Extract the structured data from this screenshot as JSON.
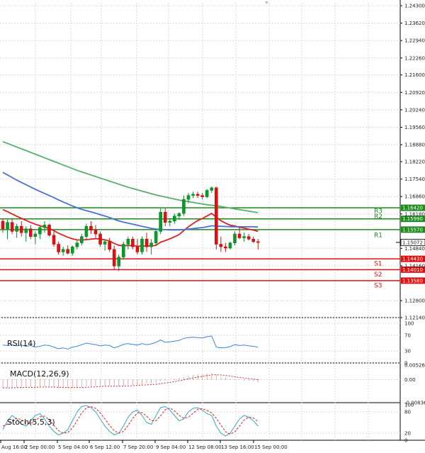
{
  "chart_data": {
    "type": "candlestick",
    "price_axis": {
      "ticks": [
        "1.24300",
        "1.23620",
        "1.22940",
        "1.22260",
        "1.21600",
        "1.20920",
        "1.20240",
        "1.19560",
        "1.18880",
        "1.18220",
        "1.17540",
        "1.16860",
        "1.16180",
        "1.14840",
        "1.14160",
        "1.12800",
        "1.12140"
      ],
      "ylim": [
        1.1214,
        1.243
      ]
    },
    "time_axis": {
      "labels": [
        "Aug 16:00",
        "2 Sep 00:00",
        "5 Sep 04:00",
        "6 Sep 12:00",
        "7 Sep 20:00",
        "9 Sep 04:00",
        "12 Sep 08:00",
        "13 Sep 16:00",
        "15 Sep 00:00"
      ]
    },
    "current_price": "1.15072",
    "levels": [
      {
        "name": "R3",
        "value": "1.16420",
        "color": "#1e8a1e"
      },
      {
        "name": "R2",
        "value": "1.15990",
        "color": "#1e8a1e"
      },
      {
        "name": "R1",
        "value": "1.15570",
        "color": "#1e8a1e"
      },
      {
        "name": "S1",
        "value": "1.14430",
        "color": "#e01010"
      },
      {
        "name": "S2",
        "value": "1.14010",
        "color": "#e01010"
      },
      {
        "name": "S3",
        "value": "1.13580",
        "color": "#e01010"
      }
    ],
    "candles": [
      [
        1.159,
        1.16,
        1.1545,
        1.156
      ],
      [
        1.156,
        1.1595,
        1.152,
        1.1585
      ],
      [
        1.1585,
        1.16,
        1.154,
        1.155
      ],
      [
        1.155,
        1.158,
        1.1525,
        1.157
      ],
      [
        1.157,
        1.159,
        1.153,
        1.1545
      ],
      [
        1.1545,
        1.157,
        1.151,
        1.156
      ],
      [
        1.156,
        1.1575,
        1.152,
        1.153
      ],
      [
        1.153,
        1.155,
        1.15,
        1.154
      ],
      [
        1.154,
        1.157,
        1.152,
        1.1565
      ],
      [
        1.1565,
        1.159,
        1.1545,
        1.1575
      ],
      [
        1.1575,
        1.158,
        1.153,
        1.1535
      ],
      [
        1.1535,
        1.155,
        1.149,
        1.15
      ],
      [
        1.15,
        1.151,
        1.146,
        1.147
      ],
      [
        1.147,
        1.149,
        1.1455,
        1.148
      ],
      [
        1.148,
        1.1495,
        1.146,
        1.1465
      ],
      [
        1.1465,
        1.1495,
        1.1455,
        1.149
      ],
      [
        1.149,
        1.1515,
        1.148,
        1.1505
      ],
      [
        1.1505,
        1.154,
        1.1495,
        1.153
      ],
      [
        1.153,
        1.158,
        1.152,
        1.157
      ],
      [
        1.157,
        1.159,
        1.154,
        1.1555
      ],
      [
        1.1555,
        1.1575,
        1.1525,
        1.154
      ],
      [
        1.154,
        1.155,
        1.149,
        1.15
      ],
      [
        1.15,
        1.152,
        1.1475,
        1.151
      ],
      [
        1.151,
        1.1525,
        1.147,
        1.148
      ],
      [
        1.148,
        1.1495,
        1.14,
        1.1415
      ],
      [
        1.1415,
        1.146,
        1.1395,
        1.145
      ],
      [
        1.145,
        1.151,
        1.144,
        1.15
      ],
      [
        1.15,
        1.153,
        1.148,
        1.152
      ],
      [
        1.152,
        1.153,
        1.148,
        1.149
      ],
      [
        1.149,
        1.152,
        1.146,
        1.147
      ],
      [
        1.147,
        1.153,
        1.146,
        1.152
      ],
      [
        1.152,
        1.1545,
        1.147,
        1.149
      ],
      [
        1.149,
        1.152,
        1.146,
        1.1505
      ],
      [
        1.1505,
        1.156,
        1.1495,
        1.155
      ],
      [
        1.155,
        1.164,
        1.154,
        1.1625
      ],
      [
        1.1625,
        1.164,
        1.157,
        1.1585
      ],
      [
        1.1585,
        1.16,
        1.157,
        1.159
      ],
      [
        1.159,
        1.162,
        1.158,
        1.161
      ],
      [
        1.161,
        1.1625,
        1.1595,
        1.162
      ],
      [
        1.162,
        1.169,
        1.161,
        1.1675
      ],
      [
        1.1675,
        1.17,
        1.166,
        1.169
      ],
      [
        1.169,
        1.1705,
        1.168,
        1.1695
      ],
      [
        1.1695,
        1.1705,
        1.168,
        1.169
      ],
      [
        1.169,
        1.17,
        1.1675,
        1.1685
      ],
      [
        1.1685,
        1.1715,
        1.168,
        1.171
      ],
      [
        1.171,
        1.1725,
        1.17,
        1.172
      ],
      [
        1.172,
        1.1725,
        1.148,
        1.15
      ],
      [
        1.15,
        1.153,
        1.147,
        1.149
      ],
      [
        1.149,
        1.1505,
        1.147,
        1.1485
      ],
      [
        1.1485,
        1.151,
        1.148,
        1.1505
      ],
      [
        1.1505,
        1.155,
        1.1495,
        1.154
      ],
      [
        1.154,
        1.157,
        1.152,
        1.1525
      ],
      [
        1.1525,
        1.1545,
        1.151,
        1.153
      ],
      [
        1.153,
        1.154,
        1.1515,
        1.152
      ],
      [
        1.152,
        1.153,
        1.1505,
        1.151
      ],
      [
        1.151,
        1.152,
        1.148,
        1.1507
      ]
    ],
    "moving_averages": [
      {
        "color": "#e02020",
        "values": [
          1.1635,
          1.1627,
          1.1618,
          1.1609,
          1.1601,
          1.1593,
          1.1585,
          1.1578,
          1.1572,
          1.1567,
          1.1561,
          1.1553,
          1.1543,
          1.1535,
          1.1527,
          1.1521,
          1.1517,
          1.1516,
          1.1518,
          1.152,
          1.1522,
          1.152,
          1.1517,
          1.1513,
          1.1503,
          1.1496,
          1.1494,
          1.1495,
          1.1495,
          1.1492,
          1.1493,
          1.1493,
          1.1493,
          1.1496,
          1.1508,
          1.1514,
          1.1521,
          1.1529,
          1.1538,
          1.1553,
          1.1568,
          1.1581,
          1.1592,
          1.16,
          1.161,
          1.162,
          1.1605,
          1.1592,
          1.1582,
          1.1574,
          1.1571,
          1.1566,
          1.1563,
          1.1559,
          1.1555,
          1.155
        ]
      },
      {
        "color": "#4a6fd8",
        "values": [
          1.178,
          1.177,
          1.176,
          1.175,
          1.1741,
          1.1732,
          1.1723,
          1.1714,
          1.1706,
          1.1698,
          1.169,
          1.1682,
          1.1673,
          1.1665,
          1.1657,
          1.1649,
          1.1642,
          1.1636,
          1.1631,
          1.1626,
          1.1621,
          1.1615,
          1.161,
          1.1604,
          1.1597,
          1.1591,
          1.1586,
          1.1582,
          1.1578,
          1.1574,
          1.157,
          1.1566,
          1.1562,
          1.1559,
          1.1558,
          1.1557,
          1.1556,
          1.1556,
          1.1556,
          1.1557,
          1.1559,
          1.1561,
          1.1563,
          1.1565,
          1.1568,
          1.1572,
          1.1571,
          1.157,
          1.1569,
          1.1568,
          1.1568,
          1.1568,
          1.1568,
          1.1568,
          1.1568,
          1.1567
        ]
      },
      {
        "color": "#56b06a",
        "values": [
          1.19,
          1.1893,
          1.1886,
          1.1879,
          1.1872,
          1.1865,
          1.1858,
          1.1851,
          1.1844,
          1.1837,
          1.183,
          1.1823,
          1.1816,
          1.1809,
          1.1802,
          1.1795,
          1.1788,
          1.1782,
          1.1776,
          1.177,
          1.1764,
          1.1758,
          1.1752,
          1.1746,
          1.174,
          1.1734,
          1.1728,
          1.1722,
          1.1717,
          1.1712,
          1.1707,
          1.1702,
          1.1697,
          1.1692,
          1.1688,
          1.1684,
          1.168,
          1.1676,
          1.1672,
          1.1669,
          1.1666,
          1.1663,
          1.166,
          1.1657,
          1.1654,
          1.1652,
          1.165,
          1.1647,
          1.1644,
          1.1641,
          1.1638,
          1.1635,
          1.1632,
          1.1629,
          1.1626,
          1.1623
        ]
      }
    ],
    "indicators": {
      "rsi": {
        "label": "RSI(14)",
        "ticks": [
          "100",
          "70",
          "30",
          "0"
        ],
        "color": "#3a86d8",
        "values": [
          45,
          44,
          46,
          43,
          45,
          42,
          44,
          40,
          42,
          45,
          44,
          40,
          36,
          38,
          35,
          40,
          42,
          46,
          50,
          48,
          46,
          43,
          45,
          44,
          38,
          42,
          47,
          49,
          47,
          45,
          49,
          46,
          48,
          52,
          58,
          52,
          53,
          55,
          57,
          62,
          64,
          65,
          64,
          63,
          66,
          68,
          40,
          38,
          39,
          41,
          46,
          44,
          45,
          43,
          42,
          40
        ]
      },
      "macd": {
        "label": "MACD(12,26,9)",
        "ticks": [
          "0.00526",
          "0.00",
          "-0.008361"
        ],
        "ylim": [
          -0.008361,
          0.00526
        ],
        "hist_color": "#c83030",
        "signal_color": "#c83030",
        "hist": [
          -0.003,
          -0.003,
          -0.0029,
          -0.0028,
          -0.0028,
          -0.0027,
          -0.0027,
          -0.0027,
          -0.0026,
          -0.0026,
          -0.0026,
          -0.0027,
          -0.0029,
          -0.003,
          -0.0031,
          -0.0031,
          -0.003,
          -0.0028,
          -0.0025,
          -0.0023,
          -0.0022,
          -0.0022,
          -0.0022,
          -0.0022,
          -0.0024,
          -0.0024,
          -0.0022,
          -0.002,
          -0.0019,
          -0.0019,
          -0.0017,
          -0.0016,
          -0.0015,
          -0.0012,
          -0.0006,
          -0.0003,
          0.0,
          0.0003,
          0.0006,
          0.001,
          0.0014,
          0.0017,
          0.0019,
          0.002,
          0.0022,
          0.0024,
          0.0017,
          0.0011,
          0.0007,
          0.0004,
          0.0002,
          -0.0001,
          -0.0003,
          -0.0005,
          -0.0006,
          -0.0008
        ],
        "signal": [
          -0.003,
          -0.003,
          -0.003,
          -0.0029,
          -0.0029,
          -0.0028,
          -0.0028,
          -0.0028,
          -0.0027,
          -0.0027,
          -0.0027,
          -0.0027,
          -0.0028,
          -0.0028,
          -0.0029,
          -0.0029,
          -0.0029,
          -0.0029,
          -0.0028,
          -0.0027,
          -0.0026,
          -0.0025,
          -0.0024,
          -0.0024,
          -0.0024,
          -0.0024,
          -0.0023,
          -0.0023,
          -0.0022,
          -0.0021,
          -0.002,
          -0.0019,
          -0.0018,
          -0.0017,
          -0.0015,
          -0.0012,
          -0.001,
          -0.0007,
          -0.0004,
          -0.0001,
          0.0003,
          0.0006,
          0.0009,
          0.0012,
          0.0015,
          0.0017,
          0.0018,
          0.0017,
          0.0015,
          0.0013,
          0.001,
          0.0008,
          0.0006,
          0.0004,
          0.0002,
          0.0
        ]
      },
      "stoch": {
        "label": "Stoch(5,5,3)",
        "ticks": [
          "100",
          "80",
          "20",
          "0"
        ],
        "main_color": "#3aa6c8",
        "signal_color": "#e02020",
        "main": [
          30,
          55,
          70,
          60,
          45,
          40,
          55,
          70,
          75,
          60,
          40,
          25,
          15,
          20,
          30,
          55,
          80,
          95,
          98,
          92,
          80,
          60,
          40,
          25,
          15,
          20,
          40,
          65,
          80,
          85,
          70,
          50,
          45,
          70,
          92,
          95,
          85,
          70,
          55,
          60,
          80,
          90,
          92,
          85,
          75,
          70,
          40,
          20,
          12,
          20,
          40,
          60,
          70,
          65,
          55,
          40
        ],
        "signal": [
          40,
          45,
          55,
          62,
          58,
          48,
          47,
          55,
          66,
          68,
          58,
          42,
          27,
          20,
          22,
          35,
          55,
          77,
          91,
          95,
          90,
          77,
          60,
          42,
          27,
          20,
          25,
          42,
          62,
          77,
          78,
          68,
          55,
          55,
          69,
          86,
          91,
          83,
          70,
          62,
          65,
          76,
          87,
          89,
          84,
          77,
          62,
          43,
          24,
          17,
          24,
          40,
          57,
          65,
          63,
          53
        ]
      }
    }
  }
}
